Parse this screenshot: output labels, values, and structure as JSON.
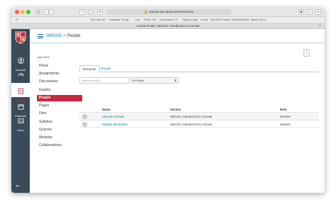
{
  "browser": {
    "address": "canvas.ws.edu/courses/1/users",
    "tab_title": "Course Roster: IWS101: Introduction to Canvas",
    "favorites": [
      "don't be evil",
      "Liturgical Things",
      "Doc",
      "Press This",
      "Grammarly & It",
      "Paypal Login",
      "Leads",
      "Add New Person",
      "ReadGenerAl...ations, inbox"
    ]
  },
  "global_nav": {
    "items": [
      {
        "label": "Account",
        "icon": "account-icon"
      },
      {
        "label": "Dashboard",
        "icon": "dashboard-icon"
      },
      {
        "label": "Courses",
        "icon": "courses-icon",
        "active": true
      },
      {
        "label": "Calendar",
        "icon": "calendar-icon"
      },
      {
        "label": "Inbox",
        "icon": "inbox-icon"
      }
    ],
    "brand_color": "#c9283e",
    "nav_color": "#394b58"
  },
  "header": {
    "course_code": "IWS101",
    "separator": ">",
    "page": "People"
  },
  "course_nav": {
    "term": "June 2019",
    "items": [
      "Home",
      "Assignments",
      "Discussions",
      "Grades",
      "People",
      "Pages",
      "Files",
      "Syllabus",
      "Quizzes",
      "Modules",
      "Collaborations"
    ],
    "active": "People"
  },
  "tabs": [
    "Everyone",
    "Groups"
  ],
  "filters": {
    "search_placeholder": "Search people",
    "role_selected": "All Roles"
  },
  "table": {
    "columns": [
      "Name",
      "Section",
      "Role"
    ],
    "rows": [
      {
        "name": "Samuel Horowitz",
        "section": "IWS101: Introduction to Canvas",
        "role": "Teacher"
      },
      {
        "name": "Student McStudent",
        "section": "IWS101: Introduction to Canvas",
        "role": "Student"
      }
    ]
  }
}
